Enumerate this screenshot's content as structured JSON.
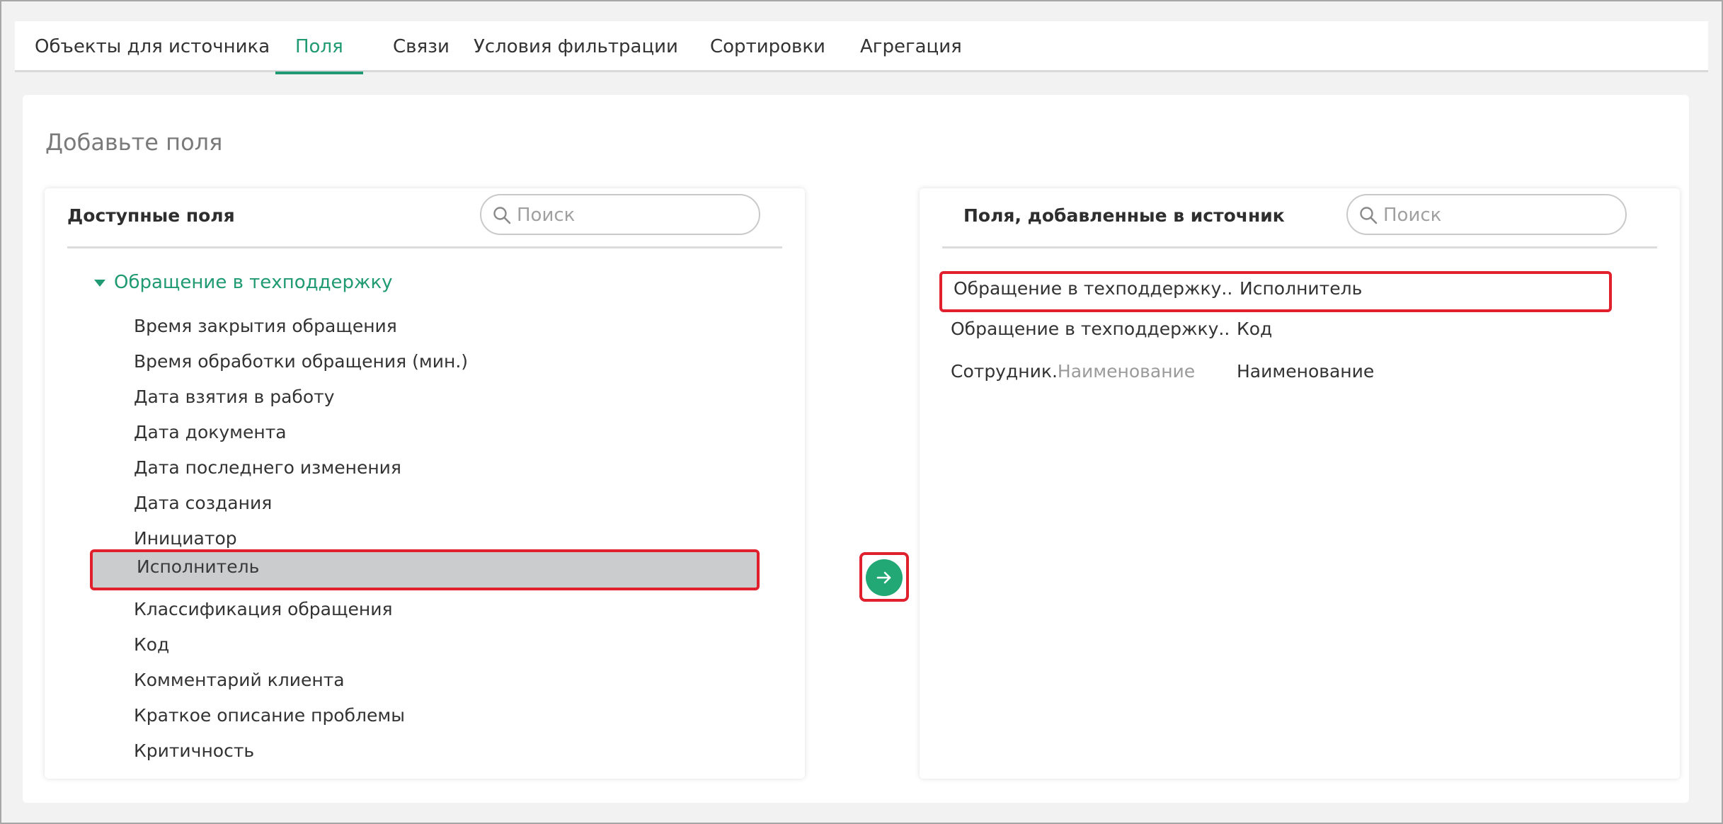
{
  "tabs": [
    {
      "label": "Объекты для источника",
      "active": false
    },
    {
      "label": "Поля",
      "active": true
    },
    {
      "label": "Связи",
      "active": false
    },
    {
      "label": "Условия фильтрации",
      "active": false
    },
    {
      "label": "Сортировки",
      "active": false
    },
    {
      "label": "Агрегация",
      "active": false
    }
  ],
  "card": {
    "title": "Добавьте поля"
  },
  "available": {
    "title": "Доступные поля",
    "search_placeholder": "Поиск",
    "group": "Обращение в техподдержку",
    "items": [
      "Время закрытия обращения",
      "Время обработки обращения (мин.)",
      "Дата взятия в работу",
      "Дата документа",
      "Дата последнего изменения",
      "Дата создания",
      "Инициатор",
      "Исполнитель",
      "Классификация обращения",
      "Код",
      "Комментарий клиента",
      "Краткое описание проблемы",
      "Критичность"
    ],
    "selected_item": "Исполнитель"
  },
  "added": {
    "title": "Поля, добавленные в источник",
    "search_placeholder": "Поиск",
    "rows": [
      {
        "path": "Обращение в техподдержку....",
        "path_muted": "",
        "name": "Исполнитель"
      },
      {
        "path": "Обращение в техподдержку....",
        "path_muted": "",
        "name": "Код"
      },
      {
        "path": "Сотрудник.",
        "path_muted": "Наименование",
        "name": "Наименование"
      }
    ]
  },
  "colors": {
    "accent": "#1f9a72",
    "highlight": "#e1202e",
    "button": "#21a874"
  },
  "icons": {
    "add": "arrow-right-icon",
    "search": "search-icon",
    "group": "caret-down-icon"
  }
}
